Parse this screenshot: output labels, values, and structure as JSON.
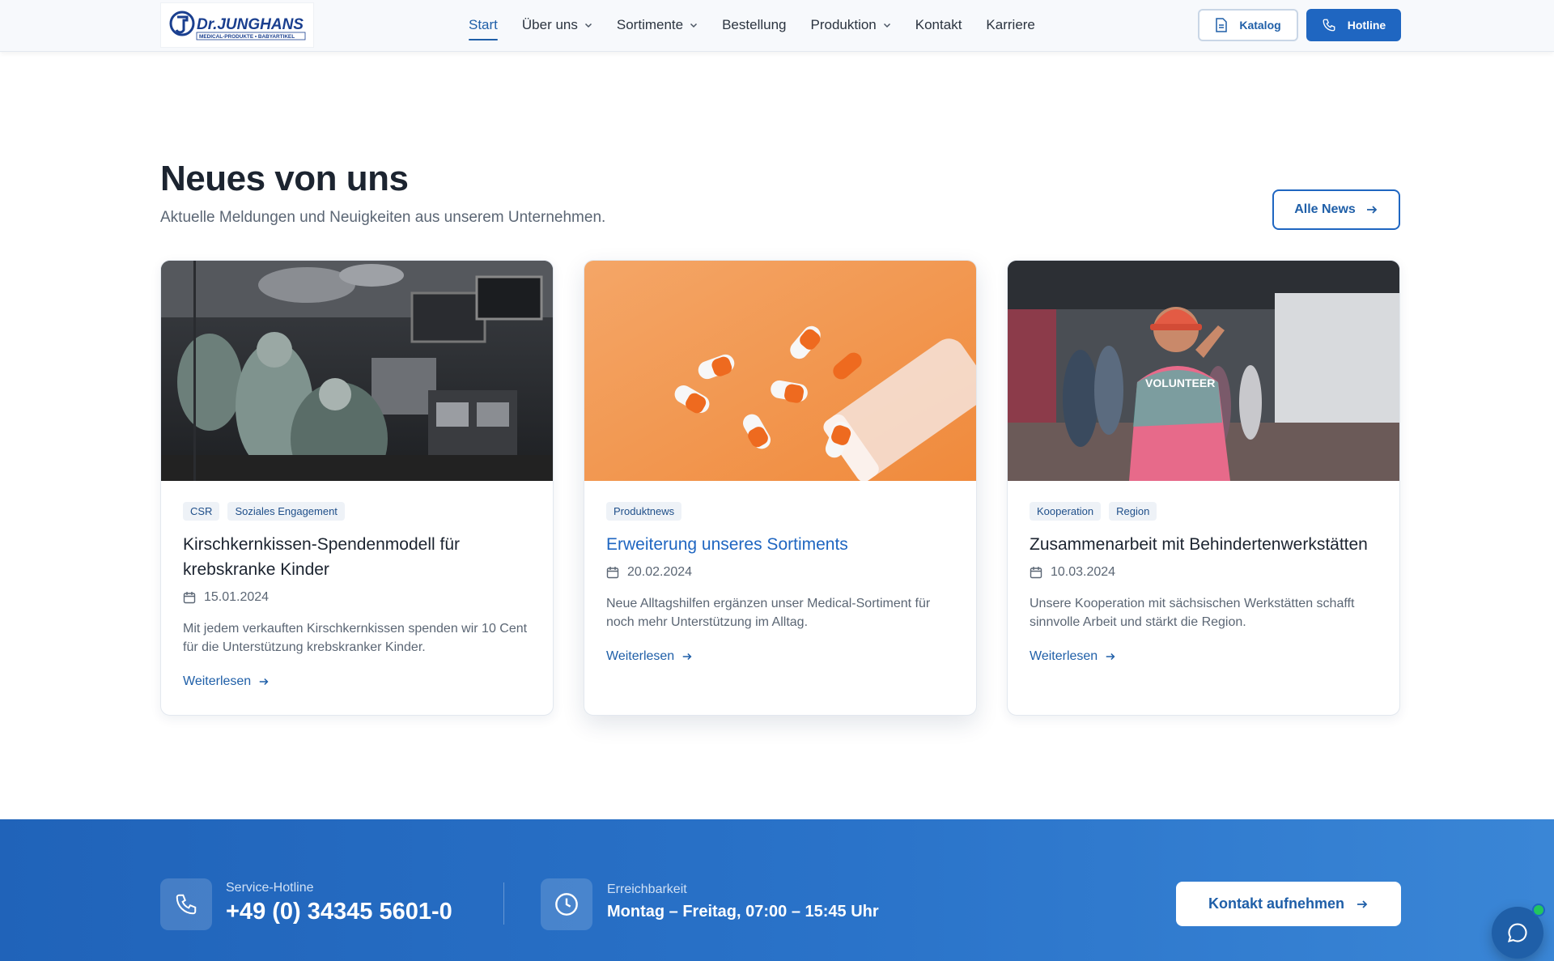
{
  "header": {
    "logo_text": "Dr.JUNGHANS",
    "logo_sub": "MEDICAL-PRODUKTE • BABYARTIKEL",
    "nav": [
      {
        "label": "Start",
        "active": true,
        "dropdown": false
      },
      {
        "label": "Über uns",
        "active": false,
        "dropdown": true
      },
      {
        "label": "Sortimente",
        "active": false,
        "dropdown": true
      },
      {
        "label": "Bestellung",
        "active": false,
        "dropdown": false
      },
      {
        "label": "Produktion",
        "active": false,
        "dropdown": true
      },
      {
        "label": "Kontakt",
        "active": false,
        "dropdown": false
      },
      {
        "label": "Karriere",
        "active": false,
        "dropdown": false
      }
    ],
    "catalog_label": "Katalog",
    "hotline_label": "Hotline"
  },
  "news": {
    "title": "Neues von uns",
    "subtitle": "Aktuelle Meldungen und Neuigkeiten aus unserem Unternehmen.",
    "all_news_label": "Alle News",
    "read_more_label": "Weiterlesen",
    "cards": [
      {
        "tags": [
          "CSR",
          "Soziales Engagement"
        ],
        "title": "Kirschkernkissen-Spendenmodell für krebskranke Kinder",
        "date": "15.01.2024",
        "excerpt": "Mit jedem verkauften Kirschkernkissen spenden wir 10 Cent für die Unterstützung krebskranker Kinder.",
        "image": "operating-room-photo"
      },
      {
        "tags": [
          "Produktnews"
        ],
        "title": "Erweiterung unseres Sortiments",
        "date": "20.02.2024",
        "excerpt": "Neue Alltagshilfen ergänzen unser Medical-Sortiment für noch mehr Unterstützung im Alltag.",
        "image": "pills-on-orange-photo"
      },
      {
        "tags": [
          "Kooperation",
          "Region"
        ],
        "title": "Zusammenarbeit mit Behindertenwerkstätten",
        "date": "10.03.2024",
        "excerpt": "Unsere Kooperation mit sächsischen Werkstätten schafft sinnvolle Arbeit und stärkt die Region.",
        "image": "volunteer-photo",
        "image_text": "VOLUNTEER"
      }
    ]
  },
  "contact_band": {
    "hotline_label": "Service-Hotline",
    "hotline_value": "+49 (0) 34345 5601-0",
    "hours_label": "Erreichbarkeit",
    "hours_value": "Montag – Freitag, 07:00 – 15:45 Uhr",
    "cta_label": "Kontakt aufnehmen"
  },
  "colors": {
    "primary": "#1f66c1",
    "band": "#2a73c9",
    "status_online": "#22c55e"
  }
}
